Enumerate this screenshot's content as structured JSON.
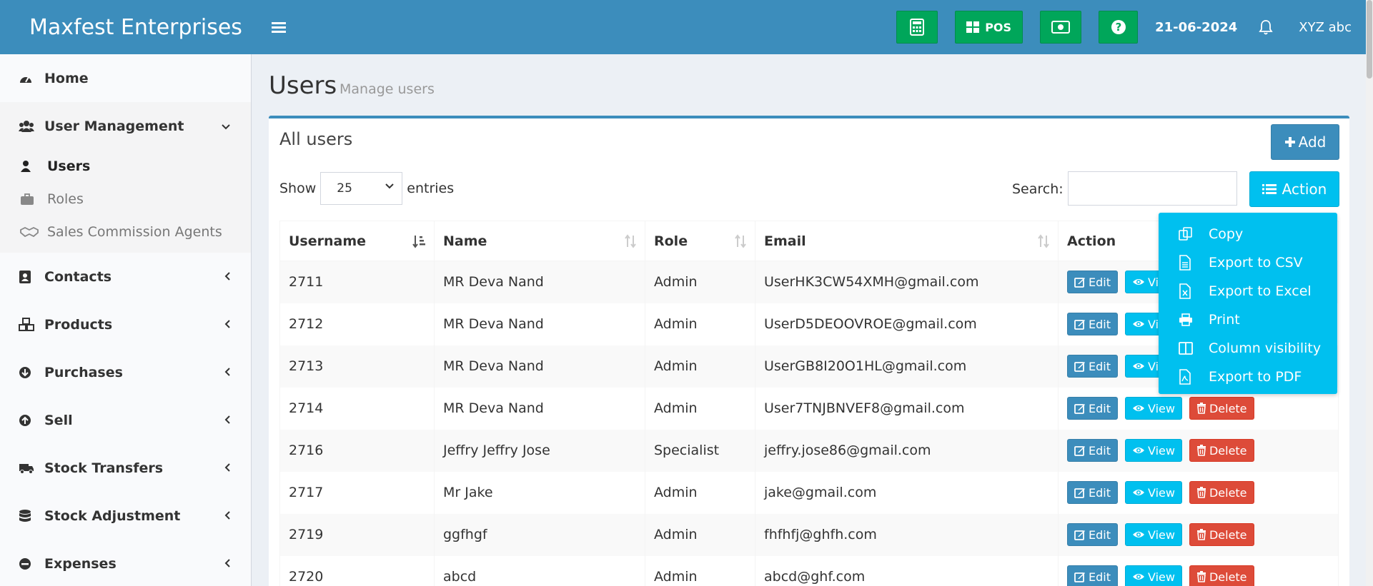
{
  "header": {
    "brand": "Maxfest Enterprises",
    "pos_label": "POS",
    "date": "21-06-2024",
    "user": "XYZ abc",
    "accent_color": "#3c8dbc",
    "button_color": "#00a65a"
  },
  "sidebar": {
    "home": "Home",
    "user_management": "User Management",
    "sub": {
      "users": "Users",
      "roles": "Roles",
      "agents": "Sales Commission Agents"
    },
    "contacts": "Contacts",
    "products": "Products",
    "purchases": "Purchases",
    "sell": "Sell",
    "stock_transfers": "Stock Transfers",
    "stock_adjustment": "Stock Adjustment",
    "expenses": "Expenses"
  },
  "page": {
    "title": "Users",
    "subtitle": "Manage users",
    "box_title": "All users",
    "add_label": "Add",
    "show_label": "Show",
    "entries_value": "25",
    "entries_label": "entries",
    "search_label": "Search:",
    "action_label": "Action"
  },
  "table": {
    "headers": {
      "username": "Username",
      "name": "Name",
      "role": "Role",
      "email": "Email",
      "action": "Action"
    },
    "buttons": {
      "edit": "Edit",
      "view": "View",
      "delete": "Delete"
    },
    "rows": [
      {
        "username": "2711",
        "name": "MR Deva Nand",
        "role": "Admin",
        "email": "UserHK3CW54XMH@gmail.com"
      },
      {
        "username": "2712",
        "name": "MR Deva Nand",
        "role": "Admin",
        "email": "UserD5DEOOVROE@gmail.com"
      },
      {
        "username": "2713",
        "name": "MR Deva Nand",
        "role": "Admin",
        "email": "UserGB8I20O1HL@gmail.com"
      },
      {
        "username": "2714",
        "name": "MR Deva Nand",
        "role": "Admin",
        "email": "User7TNJBNVEF8@gmail.com"
      },
      {
        "username": "2716",
        "name": "Jeffry Jeffry Jose",
        "role": "Specialist",
        "email": "jeffry.jose86@gmail.com"
      },
      {
        "username": "2717",
        "name": "Mr Jake",
        "role": "Admin",
        "email": "jake@gmail.com"
      },
      {
        "username": "2719",
        "name": "ggfhgf",
        "role": "Admin",
        "email": "fhfhfj@ghfh.com"
      },
      {
        "username": "2720",
        "name": "abcd",
        "role": "Admin",
        "email": "abcd@ghf.com"
      }
    ]
  },
  "action_menu": {
    "items": [
      "Copy",
      "Export to CSV",
      "Export to Excel",
      "Print",
      "Column visibility",
      "Export to PDF"
    ],
    "icons": [
      "copy-icon",
      "csv-icon",
      "excel-icon",
      "print-icon",
      "columns-icon",
      "pdf-icon"
    ]
  }
}
